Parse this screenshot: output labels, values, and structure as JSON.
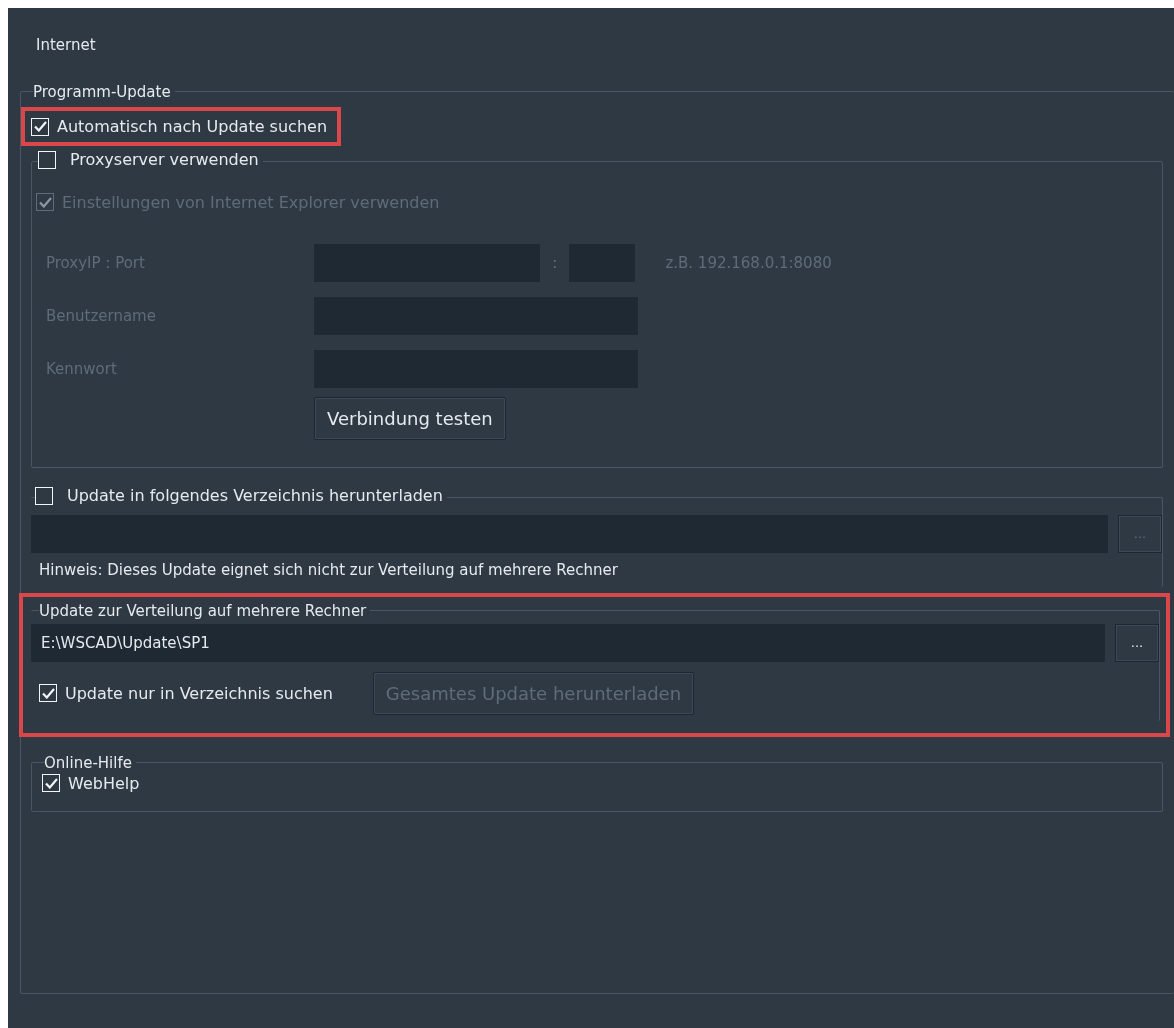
{
  "panel": {
    "title": "Internet"
  },
  "program_update": {
    "legend": "Programm-Update",
    "auto_update": {
      "label": "Automatisch nach Update suchen",
      "checked": true,
      "highlighted": true
    },
    "proxy": {
      "label": "Proxyserver verwenden",
      "checked": false,
      "ie_settings": {
        "label": "Einstellungen von Internet Explorer verwenden",
        "checked": true,
        "disabled": true
      },
      "fields": [
        {
          "kind": "ip_port",
          "label": "ProxyIP : Port",
          "separator": ":",
          "hint": "z.B. 192.168.0.1:8080",
          "disabled": true
        },
        {
          "kind": "text",
          "label": "Benutzername",
          "disabled": true
        },
        {
          "kind": "text",
          "label": "Kennwort",
          "disabled": true
        }
      ],
      "test_button": {
        "label": "Verbindung testen",
        "disabled": false
      }
    },
    "download": {
      "label": "Update in folgendes Verzeichnis herunterladen",
      "checked": false,
      "browse": {
        "label": "...",
        "disabled": true
      },
      "note": "Hinweis: Dieses Update eignet sich nicht zur Verteilung auf mehrere Rechner"
    },
    "distribution": {
      "legend": "Update zur Verteilung auf mehrere Rechner",
      "highlighted": true,
      "path": "E:\\WSCAD\\Update\\SP1",
      "browse": {
        "label": "...",
        "disabled": false
      },
      "only_directory": {
        "label": "Update nur in Verzeichnis suchen",
        "checked": true
      },
      "download_button": {
        "label": "Gesamtes Update herunterladen",
        "disabled": true
      }
    },
    "online_help": {
      "legend": "Online-Hilfe",
      "webhelp": {
        "label": "WebHelp",
        "checked": true
      }
    }
  }
}
